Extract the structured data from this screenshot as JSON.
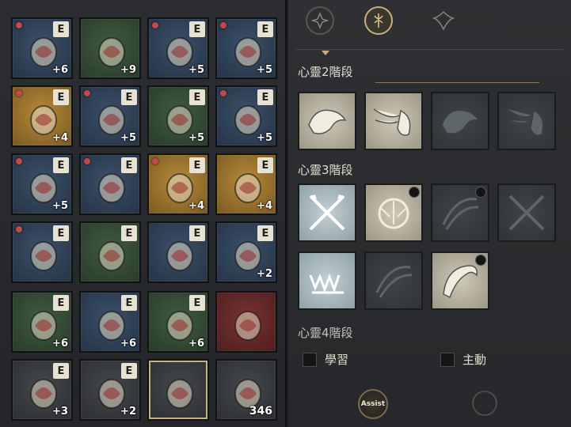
{
  "inventory": {
    "slots": [
      {
        "bg": "blue",
        "icon": "curved-blade-icon",
        "badge": "E",
        "plus": "+6",
        "gem": true
      },
      {
        "bg": "green",
        "icon": "katana-icon",
        "badge": "",
        "plus": "+9",
        "gem": false
      },
      {
        "bg": "blue",
        "icon": "circlet-icon",
        "badge": "E",
        "plus": "+5",
        "gem": true
      },
      {
        "bg": "blue",
        "icon": "chest-armor-icon",
        "badge": "E",
        "plus": "+5",
        "gem": true
      },
      {
        "bg": "orange",
        "icon": "robe-icon",
        "badge": "E",
        "plus": "+4",
        "gem": true
      },
      {
        "bg": "blue",
        "icon": "cloak-icon",
        "badge": "E",
        "plus": "+5",
        "gem": true
      },
      {
        "bg": "green",
        "icon": "pants-icon",
        "badge": "E",
        "plus": "+5",
        "gem": false
      },
      {
        "bg": "blue",
        "icon": "boots-icon",
        "badge": "E",
        "plus": "+5",
        "gem": true
      },
      {
        "bg": "blue",
        "icon": "bracer-icon",
        "badge": "E",
        "plus": "+5",
        "gem": true
      },
      {
        "bg": "blue",
        "icon": "gauntlet-icon",
        "badge": "E",
        "plus": "",
        "gem": true
      },
      {
        "bg": "orange",
        "icon": "pauldron-icon",
        "badge": "E",
        "plus": "+4",
        "gem": true
      },
      {
        "bg": "orange",
        "icon": "helmet-icon",
        "badge": "E",
        "plus": "+4",
        "gem": false
      },
      {
        "bg": "blue",
        "icon": "ring-red-icon",
        "badge": "E",
        "plus": "",
        "gem": true
      },
      {
        "bg": "green",
        "icon": "ring-gold-icon",
        "badge": "E",
        "plus": "",
        "gem": false
      },
      {
        "bg": "blue",
        "icon": "bracelet-icon",
        "badge": "E",
        "plus": "",
        "gem": false
      },
      {
        "bg": "blue",
        "icon": "earrings-icon",
        "badge": "E",
        "plus": "+2",
        "gem": false
      },
      {
        "bg": "green",
        "icon": "shield-crest-icon",
        "badge": "E",
        "plus": "+6",
        "gem": false
      },
      {
        "bg": "blue",
        "icon": "shield-crest-blue-icon",
        "badge": "E",
        "plus": "+6",
        "gem": false
      },
      {
        "bg": "green",
        "icon": "shield-crest-green-icon",
        "badge": "E",
        "plus": "+6",
        "gem": false
      },
      {
        "bg": "red",
        "icon": "scroll-icon",
        "badge": "",
        "plus": "",
        "gem": false
      },
      {
        "bg": "gray",
        "icon": "skull-emblem-icon",
        "badge": "E",
        "plus": "+3",
        "gem": false
      },
      {
        "bg": "gray",
        "icon": "ram-emblem-icon",
        "badge": "E",
        "plus": "+2",
        "gem": false
      },
      {
        "bg": "gray",
        "icon": "compass-icon",
        "badge": "",
        "plus": "",
        "gem": false,
        "selected": true
      },
      {
        "bg": "gray",
        "icon": "potion-icon",
        "badge": "",
        "plus": "",
        "gem": false,
        "count": "346"
      }
    ]
  },
  "panel": {
    "top_icons": [
      "spirit-tab-icon",
      "crest-tab-icon",
      "ornament-tab-icon"
    ],
    "sections": [
      {
        "title": "心靈2階段"
      },
      {
        "title": "心靈3階段"
      },
      {
        "title": "心靈4階段"
      }
    ],
    "checkbox_learn": "學習",
    "checkbox_active": "主動",
    "assist_label": "Assist"
  }
}
